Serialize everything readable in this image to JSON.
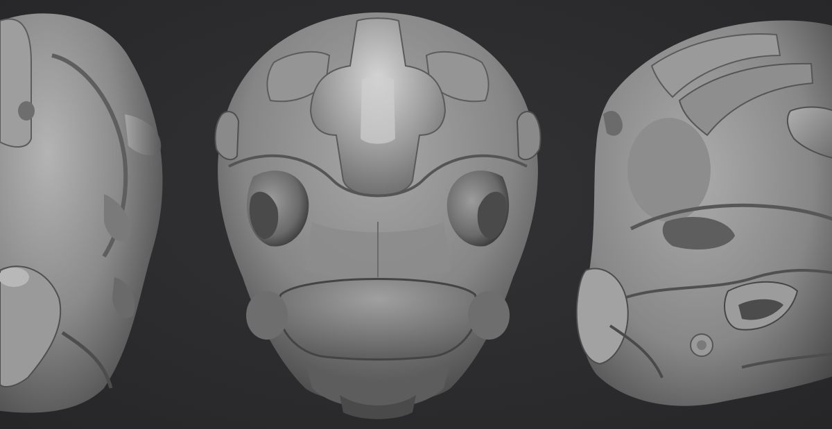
{
  "scene": {
    "background_color": "#2b2b2d",
    "material_color": "#8f8f8f",
    "views": [
      {
        "id": "left",
        "label": ""
      },
      {
        "id": "front",
        "label": ""
      },
      {
        "id": "side",
        "label": ""
      }
    ]
  }
}
